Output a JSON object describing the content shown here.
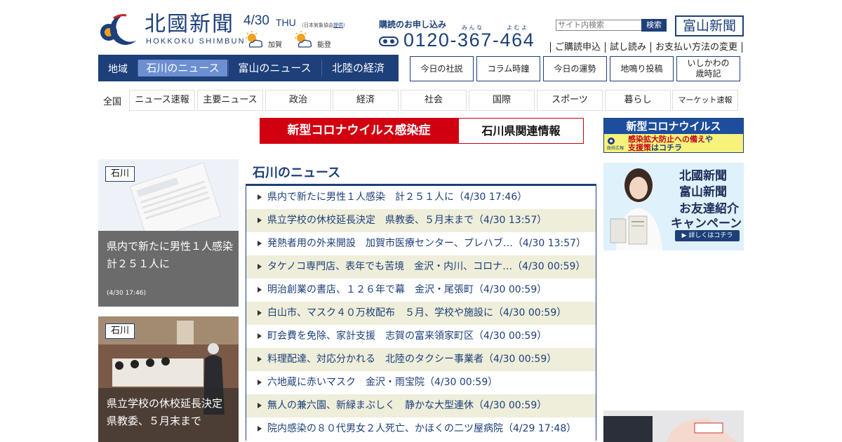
{
  "header": {
    "logo_main": "北國新聞",
    "logo_sub": "HOKKOKU SHIMBUN",
    "date": "4/30",
    "dow": "THU",
    "weather_note": "（日本気象協会",
    "weather_note_link": "提供",
    "weather_note_end": "）",
    "weather": [
      {
        "area": "加賀",
        "icon": "sun-cloud-icon"
      },
      {
        "area": "能登",
        "icon": "sun-cloud-icon"
      }
    ],
    "subscribe_title": "購読のお申し込み",
    "phone": "0120-367-464",
    "phone_ruby1": "み ん な",
    "phone_ruby2": "よ む よ",
    "search_placeholder": "サイト内検索",
    "search_button": "検索",
    "toyama_link": "富山新聞",
    "top_links": [
      "ご購読申込",
      "試し読み",
      "お支払い方法の変更"
    ]
  },
  "region_nav": {
    "label": "地域",
    "tabs": [
      "石川のニュース",
      "富山のニュース",
      "北陸の経済"
    ],
    "active": 0
  },
  "feature_buttons": [
    "今日の社説",
    "コラム時鐘",
    "今日の運勢",
    "地鳴り投稿",
    "いしかわの\n歳時記"
  ],
  "category_nav": {
    "all_label": "全国",
    "items": [
      "ニュース速報",
      "主要ニュース",
      "政治",
      "経済",
      "社会",
      "国際",
      "スポーツ",
      "暮らし",
      "マーケット速報"
    ]
  },
  "corona_banner": {
    "left": "新型コロナウイルス感染症",
    "right": "石川県関連情報"
  },
  "ads": {
    "corona_top": "新型コロナウイルス",
    "corona_line1a": "感染拡大防止への備え",
    "corona_line1b": "や",
    "corona_line2a": "支援策",
    "corona_line2b": "はコチラ",
    "corona_gov": "政府広報",
    "campaign_line1": "北國新聞",
    "campaign_line2": "富山新聞",
    "campaign_line3": "お友達紹介",
    "campaign_line4": "キャンペーン",
    "campaign_btn": "▶ 詳しくはコチラ"
  },
  "cards": [
    {
      "tag": "石川",
      "caption": "県内で新たに男性１人感染　計２５１人に",
      "date": "(4/30 17:46)"
    },
    {
      "tag": "石川",
      "caption": "県立学校の休校延長決定　県教委、５月末まで"
    }
  ],
  "news": {
    "heading": "石川のニュース",
    "items": [
      "県内で新たに男性１人感染　計２５１人に（4/30 17:46）",
      "県立学校の休校延長決定　県教委、５月末まで（4/30 13:57）",
      "発熱者用の外来開設　加賀市医療センター、プレハブ…（4/30 13:57）",
      "タケノコ専門店、表年でも苦境　金沢・内川、コロナ…（4/30 00:59）",
      "明治創業の書店、１２６年で幕　金沢・尾張町（4/30 00:59）",
      "白山市、マスク４０万枚配布　５月、学校や施設に（4/30 00:59）",
      "町会費を免除、家計支援　志賀の富来領家町区（4/30 00:59）",
      "料理配達、対応分かれる　北陸のタクシー事業者（4/30 00:59）",
      "六地蔵に赤いマスク　金沢・雨宝院（4/30 00:59）",
      "無人の兼六園、新緑まぶしく　静かな大型連休（4/30 00:59）",
      "院内感染の８０代男女２人死亡、かほくの二ツ屋病院（4/29 17:48）"
    ]
  },
  "colors": {
    "brand": "#1d3f7a",
    "corona_red": "#d10010",
    "row_alt": "#eeeeda"
  }
}
